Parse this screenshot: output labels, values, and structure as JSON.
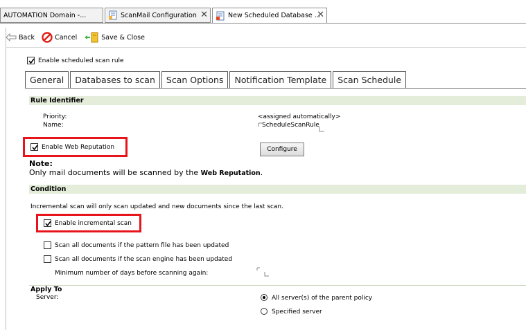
{
  "window_tabs": [
    {
      "label": "AUTOMATION Domain -..."
    },
    {
      "label": "ScanMail Configuration"
    },
    {
      "label": "New Scheduled Database ..."
    }
  ],
  "toolbar": {
    "back_label": "Back",
    "cancel_label": "Cancel",
    "save_close_label": "Save & Close"
  },
  "enable_rule": {
    "label": "Enable scheduled scan rule",
    "checked": true
  },
  "tabs": [
    {
      "label": "General"
    },
    {
      "label": "Databases to scan"
    },
    {
      "label": "Scan Options"
    },
    {
      "label": "Notification Template"
    },
    {
      "label": "Scan Schedule"
    }
  ],
  "rule_identifier": {
    "title": "Rule Identifier",
    "priority_label": "Priority:",
    "priority_value": "<assigned automatically>",
    "name_label": "Name:",
    "name_value": "ScheduleScanRule"
  },
  "web_reputation": {
    "label": "Enable Web Reputation",
    "checked": true,
    "configure_label": "Configure",
    "note_title": "Note:",
    "note_text": "Only mail documents will be scanned by the ",
    "note_bold": "Web Reputation",
    "note_end": "."
  },
  "condition": {
    "title": "Condition",
    "description": "Incremental scan will only scan updated and new documents since the last scan.",
    "incremental_label": "Enable incremental scan",
    "incremental_checked": true,
    "pattern_label": "Scan all documents if the pattern file has been updated",
    "pattern_checked": false,
    "engine_label": "Scan all documents if the scan engine has been updated",
    "engine_checked": false,
    "min_days_label": "Minimum number of days before scanning again:"
  },
  "apply_to": {
    "title": "Apply To",
    "server_label": "Server:",
    "options": [
      {
        "label": "All server(s) of the parent policy",
        "selected": true
      },
      {
        "label": "Specified server",
        "selected": false
      }
    ]
  },
  "colors": {
    "highlight": "#e8141c",
    "section_bg": "#e4ecda"
  }
}
